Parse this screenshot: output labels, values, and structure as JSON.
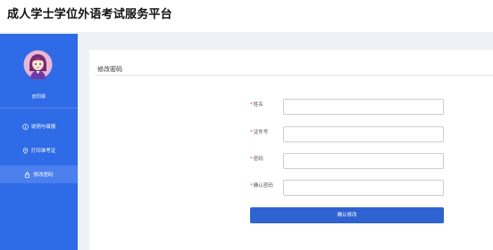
{
  "header": {
    "title": "成人学士学位外语考试服务平台"
  },
  "sidebar": {
    "user_name": "欧阳娜",
    "items": [
      {
        "label": "说明与填报",
        "icon": "info-circle-icon",
        "active": false
      },
      {
        "label": "打印准考证",
        "icon": "location-pin-icon",
        "active": false
      },
      {
        "label": "修改密码",
        "icon": "lock-icon",
        "active": true
      }
    ]
  },
  "main": {
    "title": "修改密码",
    "form": {
      "fields": [
        {
          "label": "姓名",
          "required_mark": "*",
          "value": "",
          "placeholder": ""
        },
        {
          "label": "证件号",
          "required_mark": "*",
          "value": "",
          "placeholder": ""
        },
        {
          "label": "密码",
          "required_mark": "*",
          "value": "",
          "placeholder": ""
        },
        {
          "label": "确认密码",
          "required_mark": "*",
          "value": "",
          "placeholder": ""
        }
      ],
      "submit_label": "确认修改"
    }
  },
  "colors": {
    "sidebar_bg": "#2f6be6",
    "sidebar_active": "#4b80ee",
    "primary_button": "#2f63d1",
    "page_bg": "#eef1f6",
    "required": "#e03b3b"
  }
}
